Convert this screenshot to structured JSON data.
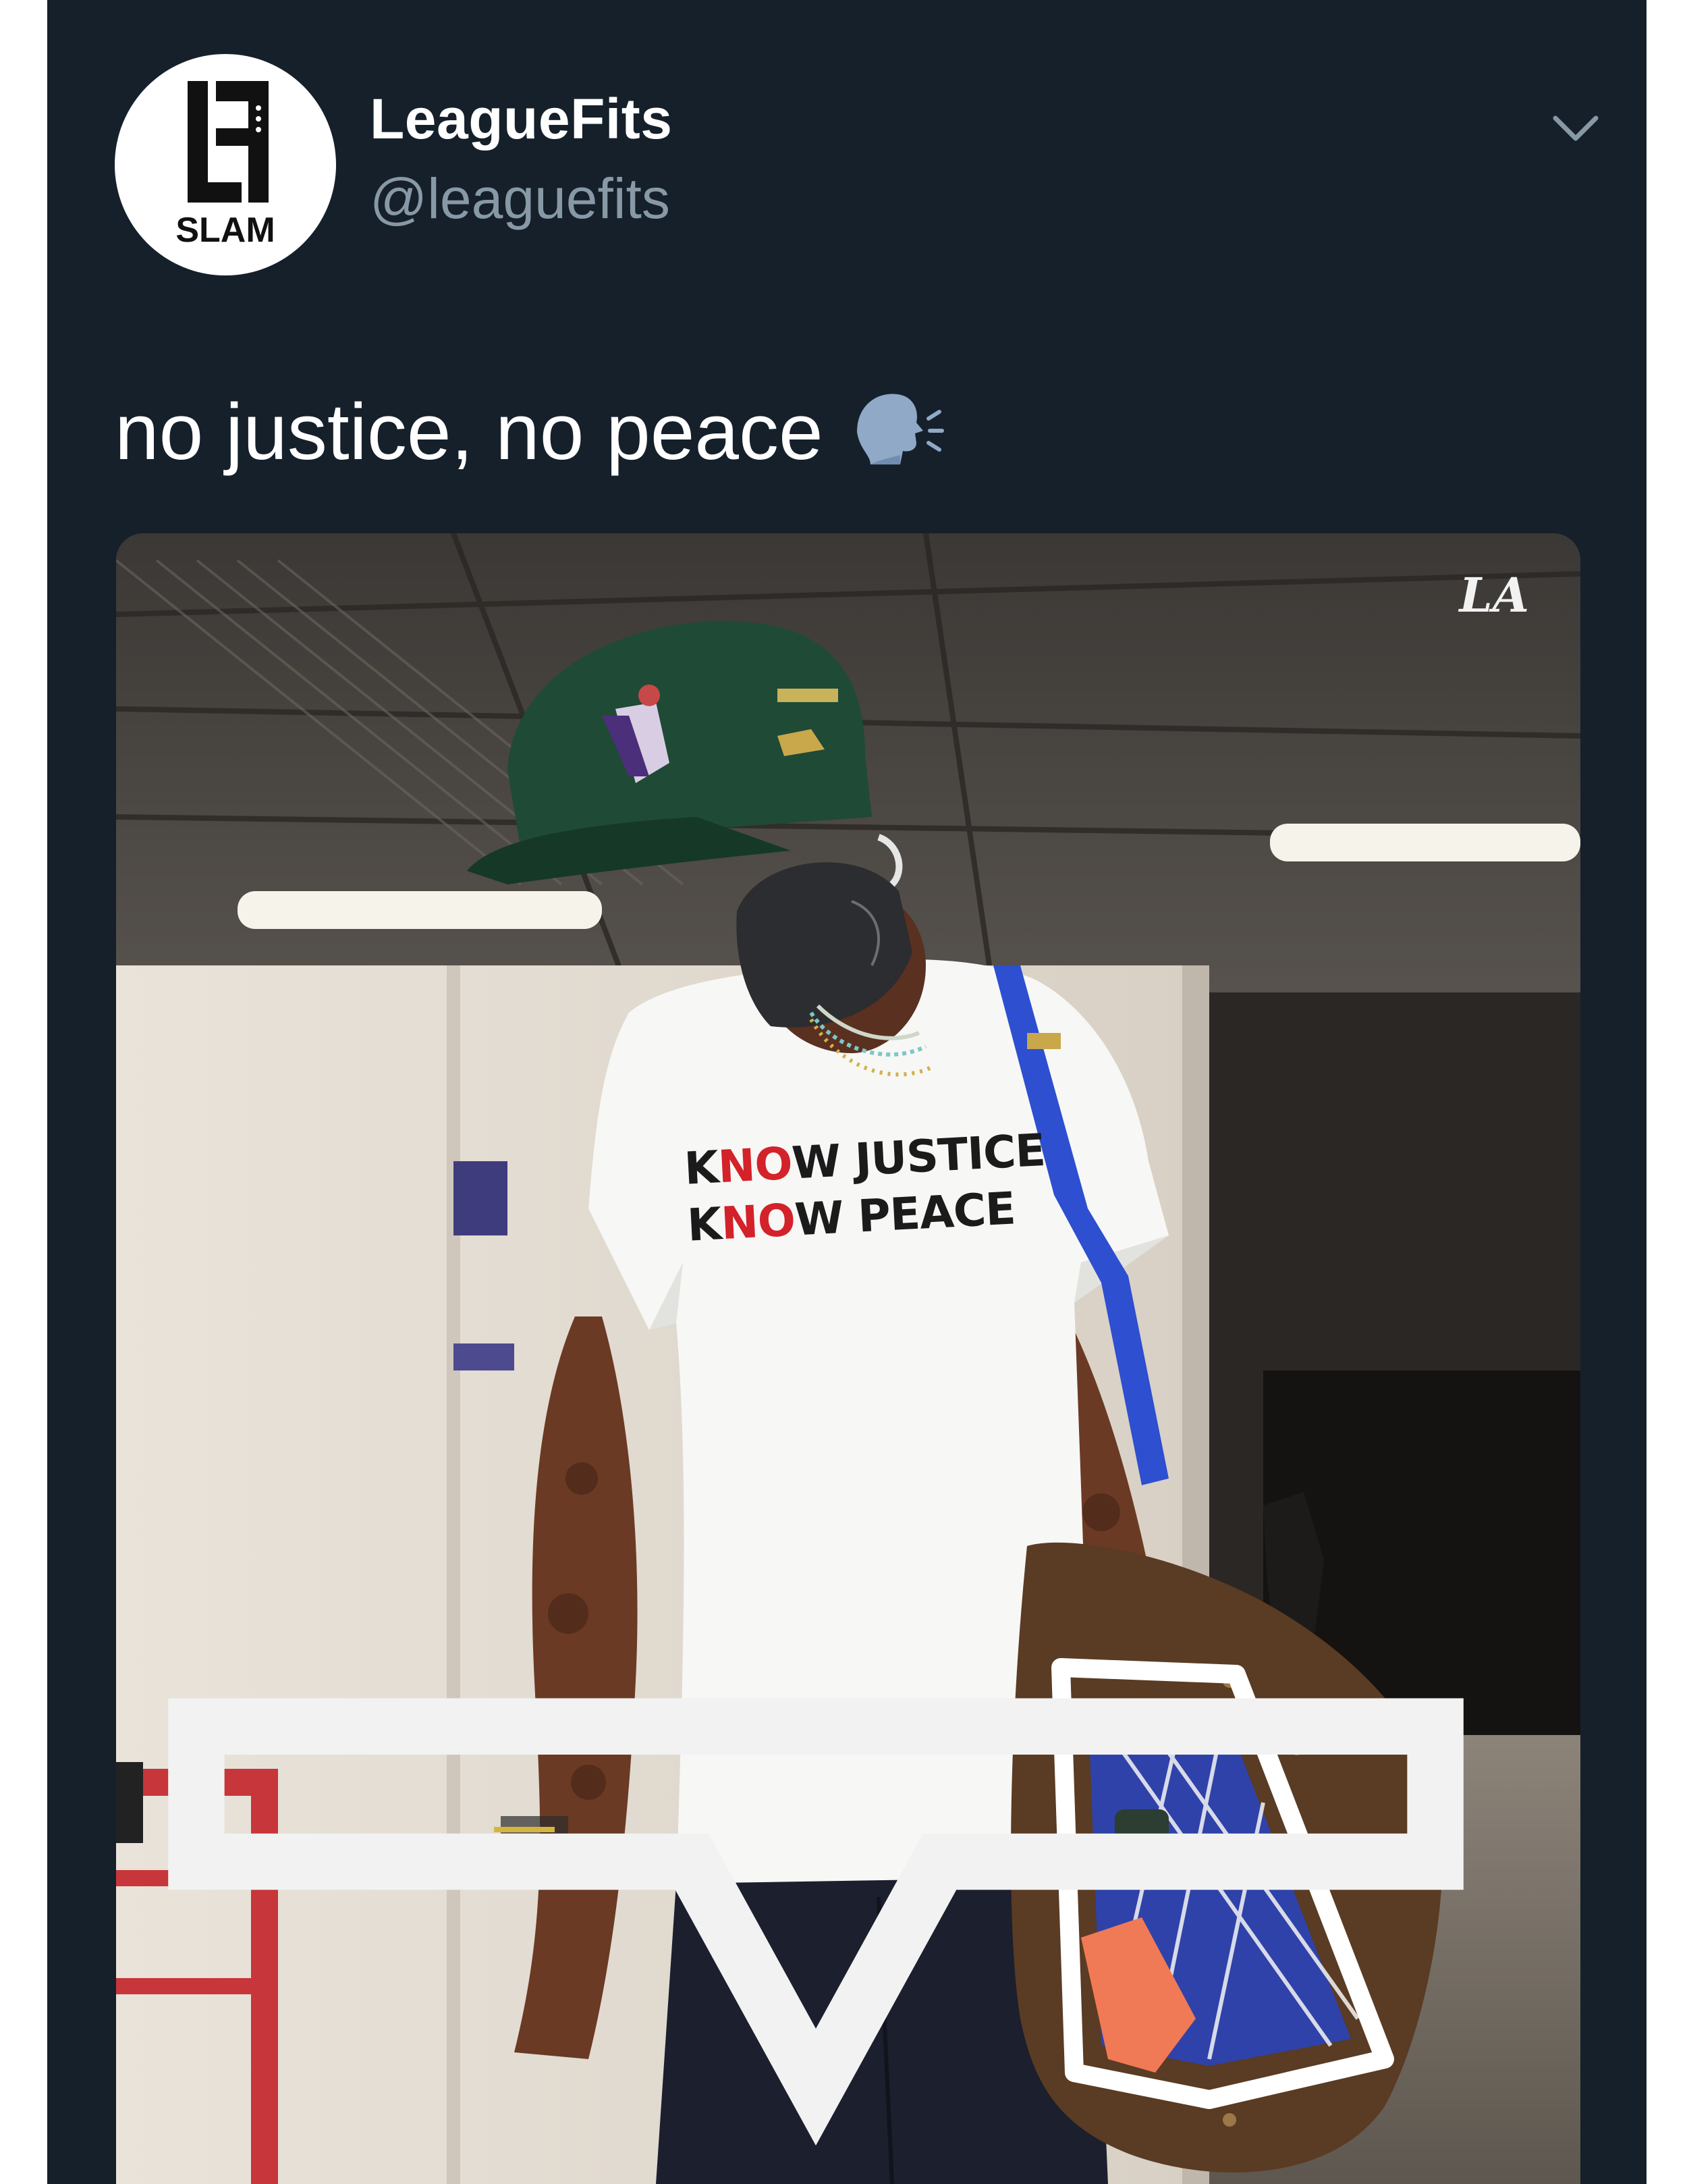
{
  "tweet": {
    "author": {
      "display_name": "LeagueFits",
      "handle": "@leaguefits",
      "avatar_logo_text": "LF",
      "avatar_brand": "SLAM"
    },
    "text": "no justice, no peace",
    "emoji": "speaking-head-icon",
    "menu_icon": "chevron-down-icon"
  },
  "media": {
    "team_logo_text": "LA",
    "shirt_line_1": {
      "red": "NO",
      "before": "K",
      "after": "W JUSTICE"
    },
    "shirt_line_2": {
      "red": "NO",
      "before": "K",
      "after": "W PEACE"
    }
  },
  "colors": {
    "background": "#15202b",
    "handle": "#8899a6",
    "text": "#ffffff"
  }
}
